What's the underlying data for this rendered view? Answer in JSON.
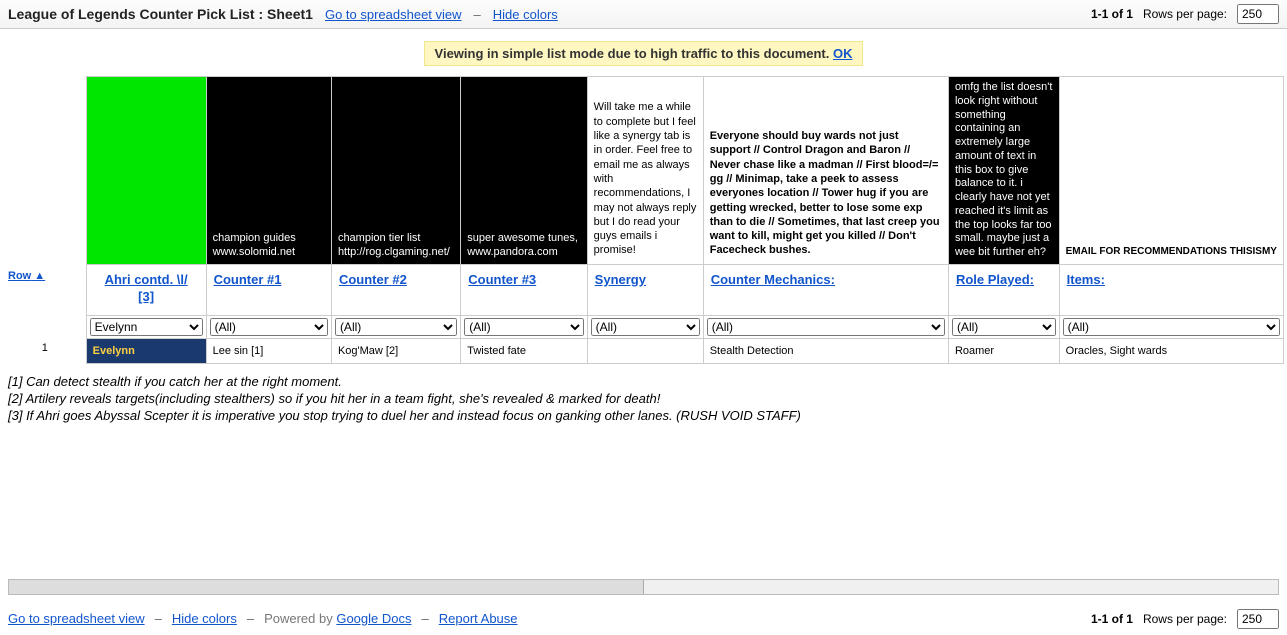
{
  "header": {
    "title": "League of Legends Counter Pick List : Sheet1",
    "gotoSpreadsheet": "Go to spreadsheet view",
    "hideColors": "Hide colors",
    "pageInfo": "1-1 of 1",
    "rowsPerPageLabel": "Rows per page:",
    "rowsPerPageValue": "250",
    "dash": "–"
  },
  "notice": {
    "text": "Viewing in simple list mode due to high traffic to this document. ",
    "ok": "OK"
  },
  "noteRow": {
    "c2": "champion guides www.solomid.net",
    "c3": "champion tier list http://rog.clgaming.net/",
    "c4": "super awesome tunes, www.pandora.com",
    "c5": "Will take me a while to complete but I feel like a synergy tab is in order. Feel free to email me as always with recommendations, I may not always reply but I do read your guys emails i promise!",
    "c6": "Everyone should buy wards not just support // Control Dragon and Baron // Never chase like a madman // First blood=/= gg // Minimap, take a peek to assess everyones location // Tower hug if you are getting wrecked, better to lose some exp than to die // Sometimes, that last creep you want to kill, might get you killed // Don't Facecheck bushes.",
    "c7": "omfg the list doesn't look right without something containing an extremely large amount of text in this box to give balance to it. i clearly have not yet reached it's limit as the top looks far too small. maybe just a wee bit further eh?",
    "c8": "EMAIL FOR RECOMMENDATIONS THISISMY"
  },
  "columnHeaders": {
    "row": "Row",
    "c1a": "Ahri contd. \\l/",
    "c1b": "[3]",
    "c2": "Counter #1",
    "c3": "Counter #2",
    "c4": "Counter #3",
    "c5": "Synergy",
    "c6": "Counter Mechanics:",
    "c7": "Role Played:",
    "c8": "Items:"
  },
  "filters": {
    "c1": "Evelynn",
    "all": "(All)"
  },
  "dataRow": {
    "num": "1",
    "c1": "Evelynn",
    "c2": "Lee sin  [1]",
    "c3": "Kog'Maw  [2]",
    "c4": "Twisted fate",
    "c5": "",
    "c6": "Stealth Detection",
    "c7": "Roamer",
    "c8": "Oracles, Sight wards"
  },
  "footnotes": {
    "n1": "[1] Can detect stealth if you catch her at the right moment.",
    "n2": "[2] Artilery reveals targets(including stealthers) so if you hit her in a team fight, she's revealed & marked for death!",
    "n3": "[3] If Ahri goes Abyssal Scepter it is imperative you stop trying to duel her and instead focus on ganking other lanes. (RUSH VOID STAFF)"
  },
  "footer": {
    "gotoSpreadsheet": "Go to spreadsheet view",
    "hideColors": "Hide colors",
    "poweredBy": "Powered by ",
    "googleDocs": "Google Docs",
    "reportAbuse": "Report Abuse",
    "pageInfo": "1-1 of 1",
    "rowsPerPageLabel": "Rows per page:",
    "rowsPerPageValue": "250",
    "dash": "–"
  }
}
